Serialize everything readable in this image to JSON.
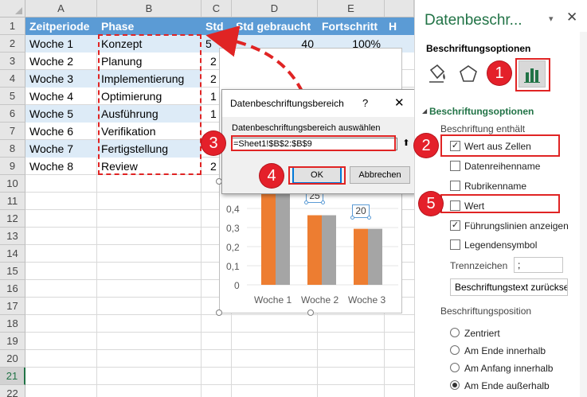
{
  "sheet": {
    "columns": [
      "A",
      "B",
      "C",
      "D",
      "E"
    ],
    "rows": [
      "1",
      "2",
      "3",
      "4",
      "5",
      "6",
      "7",
      "8",
      "9",
      "10",
      "11",
      "12",
      "13",
      "14",
      "15",
      "16",
      "17",
      "18",
      "19",
      "20",
      "21",
      "22"
    ],
    "header": {
      "a": "Zeitperiode",
      "b": "Phase",
      "c": "Std",
      "d": "Std gebraucht",
      "e": "Fortschritt",
      "f": "H"
    },
    "row2_std": "5",
    "row2_used": "40",
    "row2_progress": "100%",
    "data": [
      {
        "a": "Woche 1",
        "b": "Konzept"
      },
      {
        "a": "Woche 2",
        "b": "Planung"
      },
      {
        "a": "Woche 3",
        "b": "Implementierung"
      },
      {
        "a": "Woche 4",
        "b": "Optimierung"
      },
      {
        "a": "Woche 5",
        "b": "Ausführung"
      },
      {
        "a": "Woche 6",
        "b": "Verifikation"
      },
      {
        "a": "Woche 7",
        "b": "Fertigstellung"
      },
      {
        "a": "Woche 8",
        "b": "Review"
      }
    ],
    "c_partial": [
      "2",
      "2",
      "1",
      "1",
      "2",
      "2"
    ]
  },
  "chart_data": {
    "type": "bar",
    "categories": [
      "Woche 1",
      "Woche 2",
      "Woche 3"
    ],
    "series": [
      {
        "color": "#ed7d31",
        "values": [
          0.6,
          0.41,
          0.33
        ]
      },
      {
        "color": "#a5a5a5",
        "values": [
          0.6,
          0.41,
          0.33
        ]
      }
    ],
    "yticks": [
      "0,4",
      "0,3",
      "0,2",
      "0,1",
      "0"
    ],
    "data_labels": [
      "25",
      "20"
    ],
    "ylim": [
      0,
      0.45
    ]
  },
  "dialog": {
    "title": "Datenbeschriftungsbereich",
    "help": "?",
    "close": "✕",
    "prompt": "Datenbeschriftungsbereich auswählen",
    "range": "=Sheet1!$B$2:$B$9",
    "collapse": "⬆",
    "ok": "OK",
    "cancel": "Abbrechen"
  },
  "badges": [
    "1",
    "2",
    "3",
    "4",
    "5"
  ],
  "pane": {
    "title": "Datenbeschr...",
    "menu": "▾",
    "close": "✕",
    "section_title": "Beschriftungsoptionen",
    "group_title": "Beschriftungsoptionen",
    "contains_label": "Beschriftung enthält",
    "options": [
      {
        "label": "Wert aus Zellen",
        "checked": true
      },
      {
        "label": "Datenreihenname",
        "checked": false
      },
      {
        "label": "Rubrikenname",
        "checked": false
      },
      {
        "label": "Wert",
        "checked": false
      },
      {
        "label": "Führungslinien anzeigen",
        "checked": true
      },
      {
        "label": "Legendensymbol",
        "checked": false
      }
    ],
    "separator_label": "Trennzeichen",
    "separator_value": ";",
    "reset_button": "Beschriftungstext zurücksetzen",
    "position_label": "Beschriftungsposition",
    "positions": [
      {
        "label": "Zentriert",
        "selected": false
      },
      {
        "label": "Am Ende innerhalb",
        "selected": false
      },
      {
        "label": "Am Anfang innerhalb",
        "selected": false
      },
      {
        "label": "Am Ende außerhalb",
        "selected": true
      }
    ]
  },
  "colors": {
    "header_blue": "#5b9bd5",
    "band_blue": "#ddebf7",
    "excel_green": "#217346",
    "marker_red": "#e02424"
  }
}
